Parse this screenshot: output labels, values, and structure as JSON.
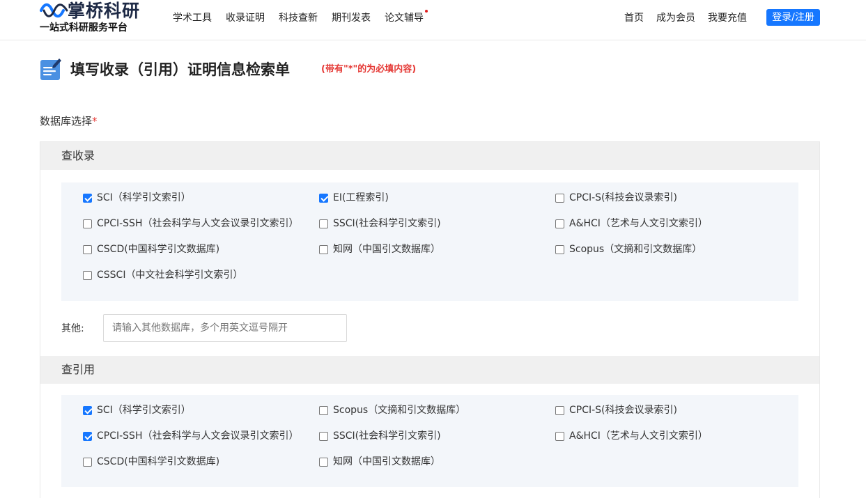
{
  "header": {
    "logo": {
      "name": "掌桥科研",
      "slogan": "一站式科研服务平台",
      "mark_color": "#1677ff"
    },
    "nav": [
      {
        "label": "学术工具"
      },
      {
        "label": "收录证明"
      },
      {
        "label": "科技查新"
      },
      {
        "label": "期刊发表"
      },
      {
        "label": "论文辅导",
        "has_dot": true
      }
    ],
    "right_links": [
      {
        "label": "首页"
      },
      {
        "label": "成为会员"
      },
      {
        "label": "我要充值"
      }
    ],
    "login_label": "登录/注册",
    "accent_color": "#1677ff"
  },
  "page": {
    "title": "填写收录（引用）证明信息检索单",
    "note": "(带有\"*\"的为必填内容)",
    "title_icon": "edit-document-icon"
  },
  "database_section": {
    "label": "数据库选择",
    "required_mark": "*",
    "inclusion": {
      "title": "查收录",
      "options": [
        {
          "label": "SCI（科学引文索引）",
          "checked": true
        },
        {
          "label": "EI(工程索引)",
          "checked": true
        },
        {
          "label": "CPCI-S(科技会议录索引)",
          "checked": false
        },
        {
          "label": "CPCI-SSH（社会科学与人文会议录引文索引）",
          "checked": false
        },
        {
          "label": "SSCI(社会科学引文索引)",
          "checked": false
        },
        {
          "label": "A&HCI（艺术与人文引文索引）",
          "checked": false
        },
        {
          "label": "CSCD(中国科学引文数据库)",
          "checked": false
        },
        {
          "label": "知网（中国引文数据库）",
          "checked": false
        },
        {
          "label": "Scopus（文摘和引文数据库）",
          "checked": false
        },
        {
          "label": "CSSCI（中文社会科学引文索引）",
          "checked": false
        }
      ],
      "other_label": "其他:",
      "other_placeholder": "请输入其他数据库，多个用英文逗号隔开",
      "other_value": ""
    },
    "citation": {
      "title": "查引用",
      "options": [
        {
          "label": "SCI（科学引文索引）",
          "checked": true
        },
        {
          "label": "Scopus（文摘和引文数据库）",
          "checked": false
        },
        {
          "label": "CPCI-S(科技会议录索引)",
          "checked": false
        },
        {
          "label": "CPCI-SSH（社会科学与人文会议录引文索引）",
          "checked": true
        },
        {
          "label": "SSCI(社会科学引文索引)",
          "checked": false
        },
        {
          "label": "A&HCI（艺术与人文引文索引）",
          "checked": false
        },
        {
          "label": "CSCD(中国科学引文数据库)",
          "checked": false
        },
        {
          "label": "知网（中国引文数据库）",
          "checked": false
        }
      ]
    }
  }
}
